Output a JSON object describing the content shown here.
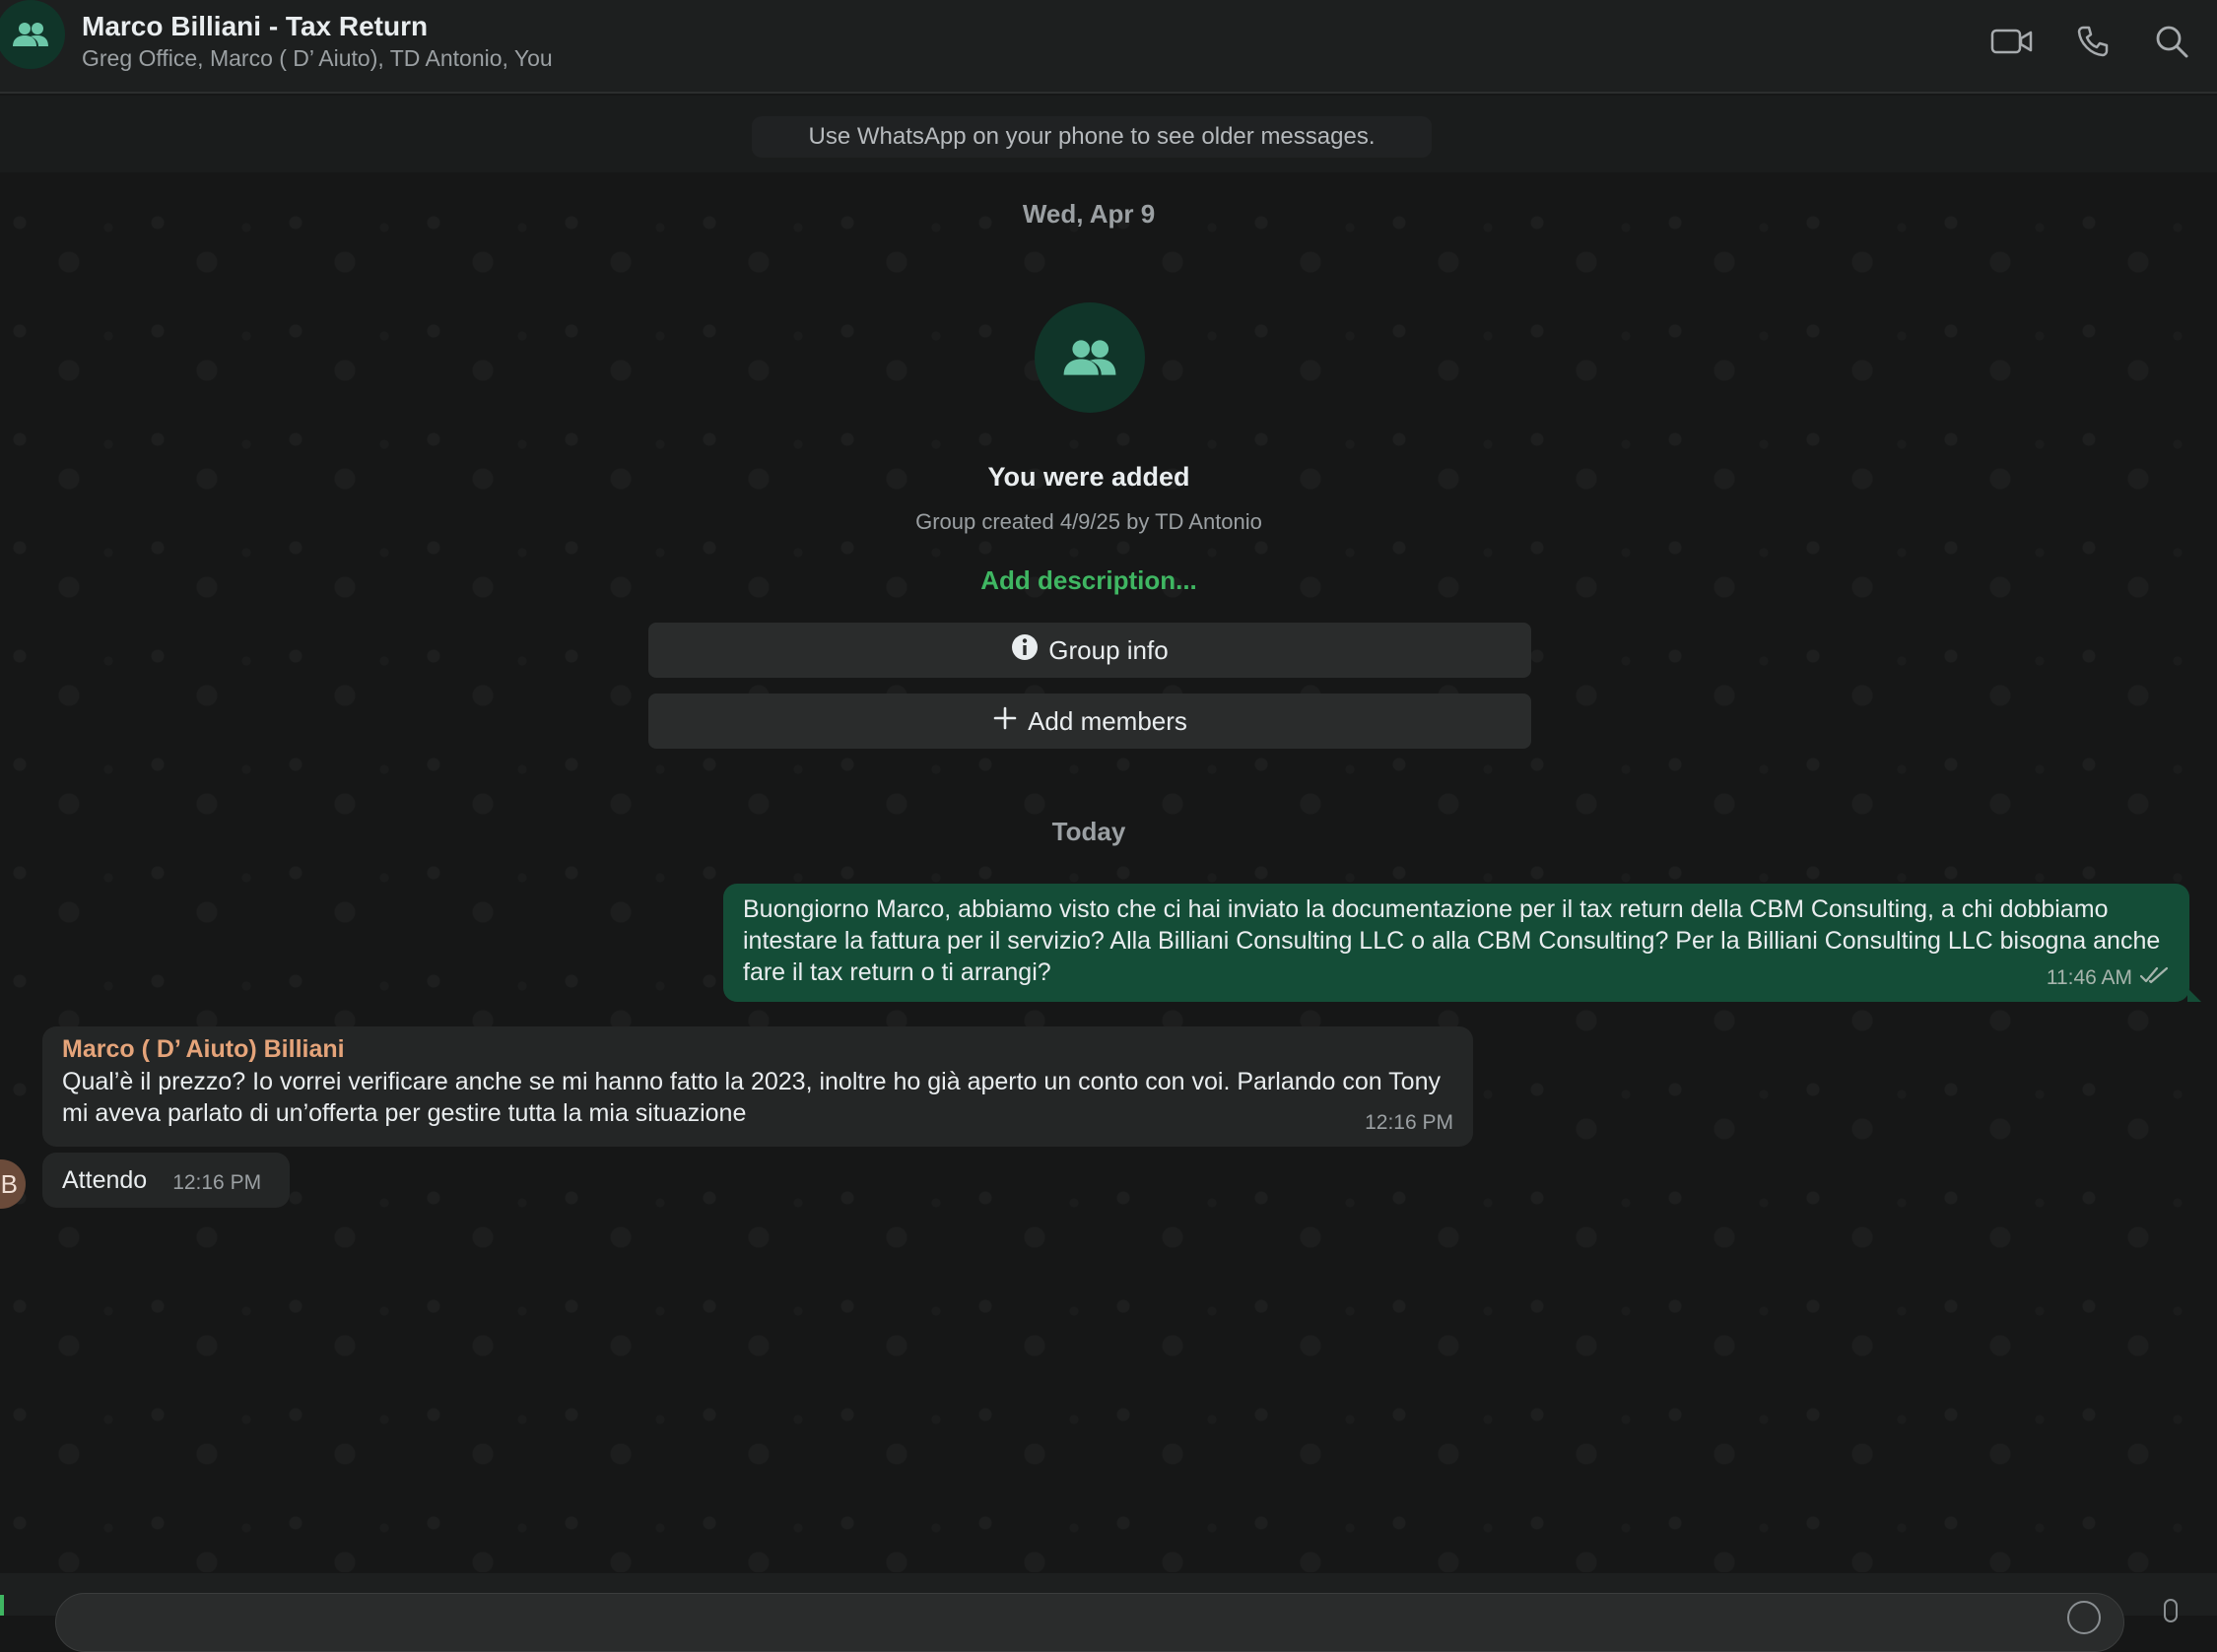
{
  "header": {
    "title": "Marco Billiani - Tax Return",
    "subtitle": "Greg Office, Marco ( D’ Aiuto), TD Antonio, You",
    "icons": [
      "group-avatar-icon",
      "video-call-icon",
      "phone-icon",
      "search-icon"
    ]
  },
  "banner": {
    "older_messages": "Use WhatsApp on your phone to see older messages."
  },
  "system": {
    "date_first": "Wed, Apr 9",
    "you_added": "You were added",
    "group_created": "Group created 4/9/25 by TD Antonio",
    "add_description": "Add description...",
    "group_info_label": "Group info",
    "add_members_label": "Add members",
    "date_today": "Today"
  },
  "messages": [
    {
      "direction": "outgoing",
      "text": "Buongiorno Marco, abbiamo visto che ci hai inviato la documentazione per il tax return della CBM Consulting, a chi dobbiamo intestare la fattura per il servizio? Alla Billiani Consulting LLC o alla CBM Consulting? Per la Billiani Consulting LLC bisogna anche fare il tax return o ti arrangi?",
      "time": "11:46 AM",
      "status": "read"
    },
    {
      "direction": "incoming",
      "sender": "Marco ( D’ Aiuto) Billiani",
      "text": "Qual’è il prezzo? Io vorrei verificare anche se mi hanno fatto la 2023, inoltre ho già aperto un conto con voi. Parlando con Tony mi aveva parlato di un’offerta per gestire tutta la mia situazione",
      "time": "12:16 PM"
    },
    {
      "direction": "incoming",
      "text": "Attendo",
      "time": "12:16 PM",
      "avatar_initial": "B"
    }
  ],
  "colors": {
    "background": "#161717",
    "header": "#1d1f1f",
    "outgoing_bubble": "#144d37",
    "incoming_bubble": "#242626",
    "accent_green": "#3fb662",
    "sender_name": "#e5a47a"
  }
}
